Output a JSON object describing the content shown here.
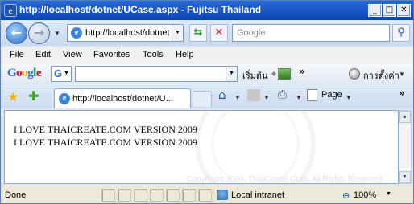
{
  "window": {
    "title": "http://localhost/dotnet/UCase.aspx - Fujitsu Thailand",
    "minimize_label": "_",
    "maximize_label": "□",
    "close_label": "✕"
  },
  "address": {
    "url": "http://localhost/dotnet/UCase.aspx",
    "search_placeholder": "Google"
  },
  "menu": {
    "items": [
      "File",
      "Edit",
      "View",
      "Favorites",
      "Tools",
      "Help"
    ]
  },
  "google_toolbar": {
    "logo": "Google",
    "go_label": "เริ่มต้น",
    "settings_label": "การตั้งค่า"
  },
  "tabs": {
    "active_tab": "http://localhost/dotnet/U...",
    "page_menu": "Page"
  },
  "content": {
    "lines": [
      "I LOVE THAICREATE.COM VERSION 2009",
      "I LOVE THAICREATE.COM VERSION 2009"
    ],
    "copyright": "CopyRight 2009, ThaiCreate.Com, All Rights Reserved"
  },
  "status": {
    "text": "Done",
    "zone": "Local intranet",
    "zoom": "100%"
  },
  "colors": {
    "titlebar": "#0a44b4",
    "accent": "#2a6ad6"
  }
}
